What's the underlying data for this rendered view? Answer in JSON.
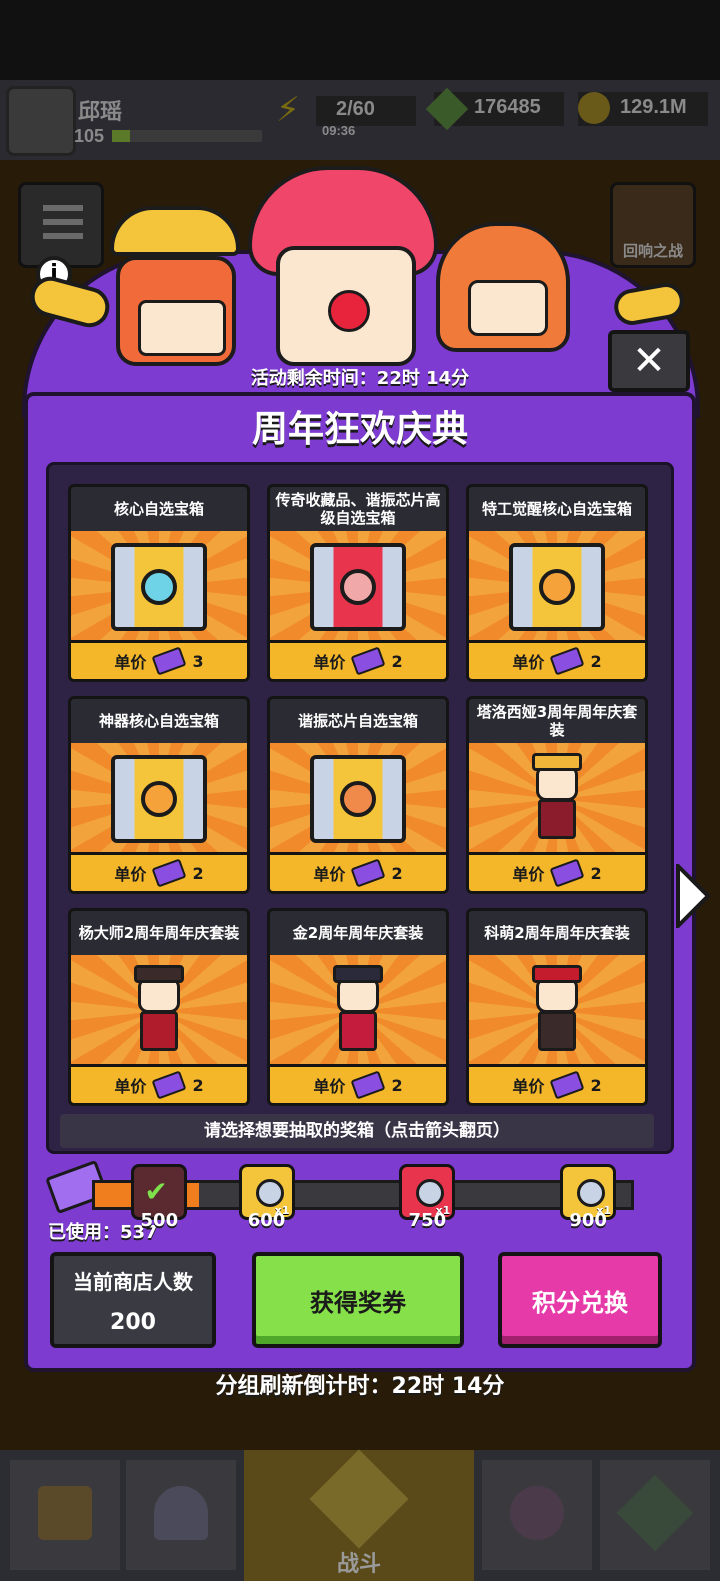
{
  "hud": {
    "player_name": "邱瑶",
    "player_level": "105",
    "energy": "2/60",
    "energy_timer": "09:36",
    "gems": "176485",
    "gold": "129.1M"
  },
  "side_labels": {
    "echo_battle": "回响之战"
  },
  "event": {
    "remaining_time": "活动剩余时间：22时 14分",
    "title": "周年狂欢庆典",
    "close_icon": "close-icon",
    "info_icon": "info-icon"
  },
  "cards": [
    {
      "title": "核心自选宝箱",
      "price_label": "单价",
      "price": "3",
      "kind": "chest",
      "color": "#f4c53a",
      "lock": "#6fd3e8"
    },
    {
      "title": "传奇收藏品、谐振芯片高级自选宝箱",
      "price_label": "单价",
      "price": "2",
      "kind": "chest",
      "color": "#e8344c",
      "lock": "#f0a8a8"
    },
    {
      "title": "特工觉醒核心自选宝箱",
      "price_label": "单价",
      "price": "2",
      "kind": "chest",
      "color": "#f4c53a",
      "lock": "#f5a23a"
    },
    {
      "title": "神器核心自选宝箱",
      "price_label": "单价",
      "price": "2",
      "kind": "chest",
      "color": "#f4c53a",
      "lock": "#f5a23a"
    },
    {
      "title": "谐振芯片自选宝箱",
      "price_label": "单价",
      "price": "2",
      "kind": "chest",
      "color": "#f4c53a",
      "lock": "#f08a4a"
    },
    {
      "title": "塔洛西娅3周年周年庆套装",
      "price_label": "单价",
      "price": "2",
      "kind": "figure",
      "color": "#f0b63a",
      "accent": "#8a1c2c"
    },
    {
      "title": "杨大师2周年周年庆套装",
      "price_label": "单价",
      "price": "2",
      "kind": "figure",
      "color": "#3a2a2a",
      "accent": "#b01c2c"
    },
    {
      "title": "金2周年周年庆套装",
      "price_label": "单价",
      "price": "2",
      "kind": "figure",
      "color": "#2a2a3a",
      "accent": "#c41c3c"
    },
    {
      "title": "科萌2周年周年庆套装",
      "price_label": "单价",
      "price": "2",
      "kind": "figure",
      "color": "#c41c2c",
      "accent": "#3a2a2a"
    }
  ],
  "hint": "请选择想要抽取的奖箱（点击箭头翻页）",
  "progress": {
    "used_label": "已使用：537",
    "used": 537,
    "max": 900,
    "milestones": [
      {
        "value": "500",
        "color": "#5a2a30",
        "claimed": true
      },
      {
        "value": "600",
        "color": "#f4c53a",
        "badge": "x1"
      },
      {
        "value": "750",
        "color": "#e8344c",
        "badge": "x1"
      },
      {
        "value": "900",
        "color": "#f4c53a",
        "badge": "x1"
      }
    ]
  },
  "shop": {
    "label": "当前商店人数",
    "count": "200"
  },
  "buttons": {
    "get_tickets": "获得奖券",
    "exchange": "积分兑换"
  },
  "refresh": "分组刷新倒计时：22时 14分",
  "bottom_nav": {
    "battle": "战斗"
  },
  "colors": {
    "panel": "#7d3bd0",
    "green_button": "#86e04a",
    "pink_button": "#e63aa8",
    "price_bar": "#f4b72a"
  }
}
